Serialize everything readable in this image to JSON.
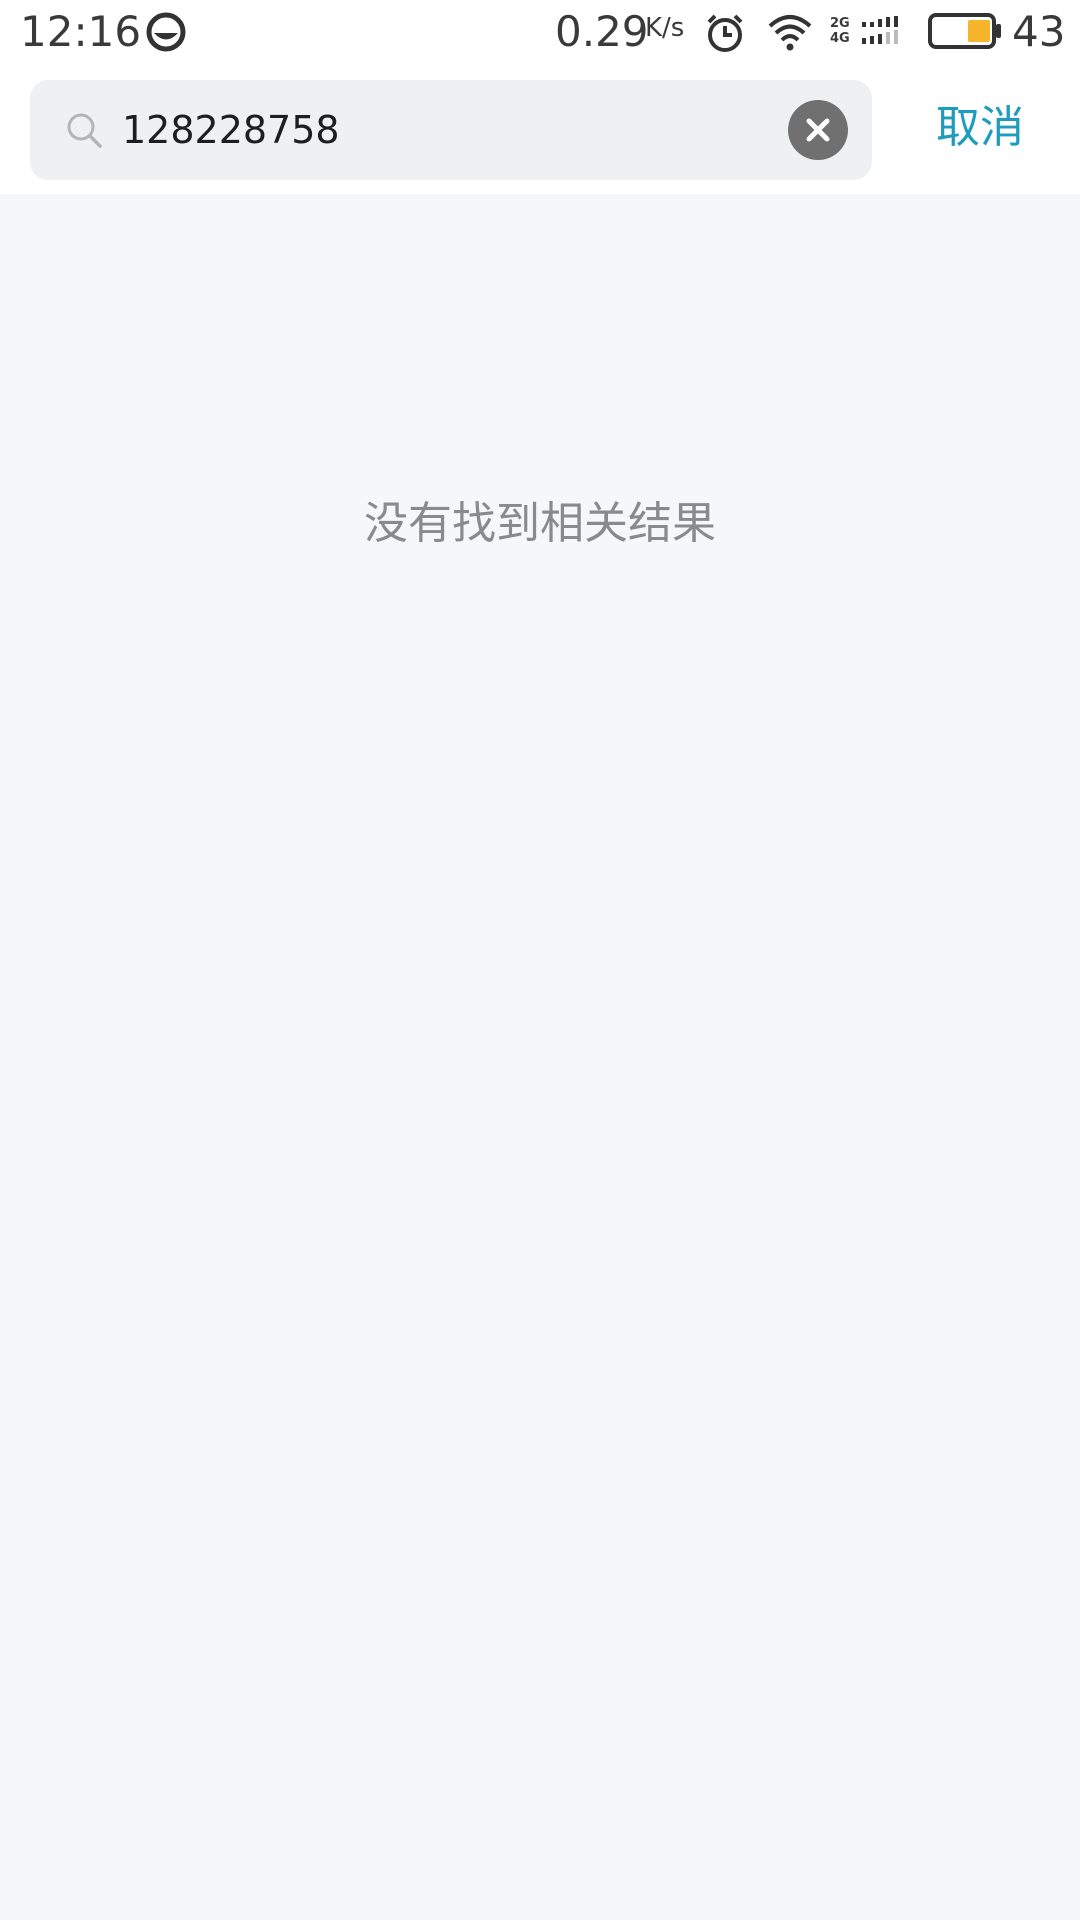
{
  "status_bar": {
    "time": "12:16",
    "net_speed": "0.29",
    "net_speed_unit": "K/s",
    "network_types": "2G\n4G",
    "battery_level": "43",
    "battery_color": "#f7b52c"
  },
  "search": {
    "query": "128228758",
    "cancel_label": "取消",
    "accent_color": "#1f9bc0"
  },
  "content": {
    "empty_message": "没有找到相关结果"
  }
}
